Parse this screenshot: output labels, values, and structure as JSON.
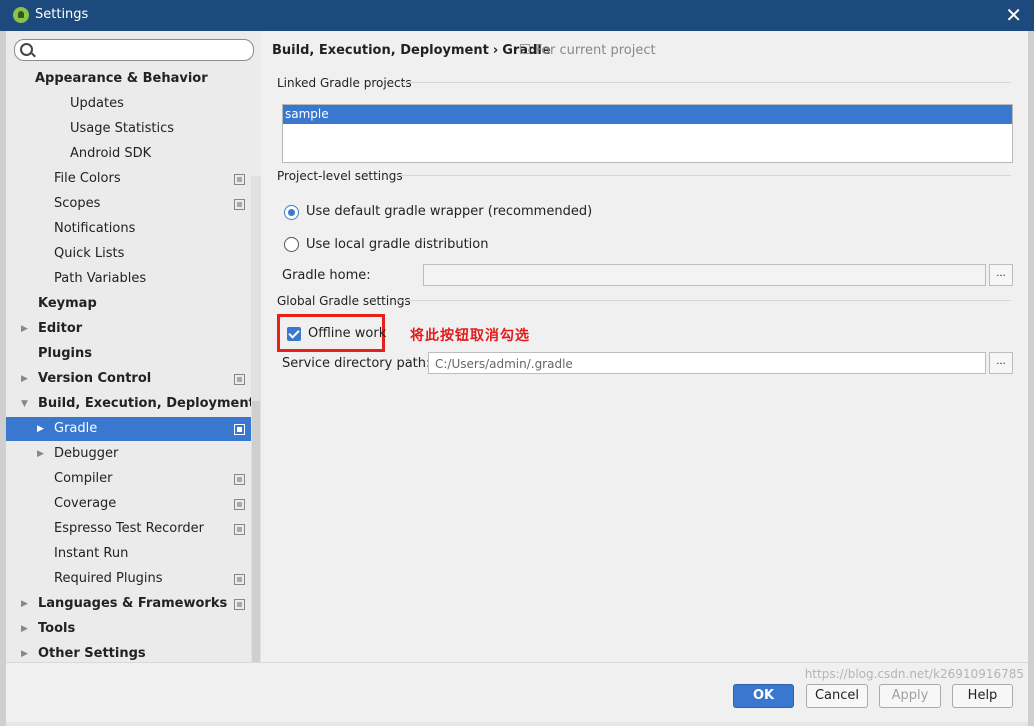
{
  "window": {
    "title": "Settings",
    "close_label": "✕"
  },
  "search": {
    "value": "",
    "placeholder": ""
  },
  "sidebar": {
    "items": [
      {
        "label": "Appearance & Behavior",
        "bold": true,
        "arrow": ""
      },
      {
        "label": "Updates"
      },
      {
        "label": "Usage Statistics"
      },
      {
        "label": "Android SDK"
      },
      {
        "label": "File Colors",
        "project": true
      },
      {
        "label": "Scopes",
        "project": true
      },
      {
        "label": "Notifications"
      },
      {
        "label": "Quick Lists"
      },
      {
        "label": "Path Variables"
      },
      {
        "label": "Keymap",
        "bold": true
      },
      {
        "label": "Editor",
        "bold": true,
        "arrow": "▶"
      },
      {
        "label": "Plugins",
        "bold": true
      },
      {
        "label": "Version Control",
        "bold": true,
        "arrow": "▶",
        "project": true
      },
      {
        "label": "Build, Execution, Deployment",
        "bold": true,
        "arrow": "▼"
      },
      {
        "label": "Gradle",
        "arrow": "▶",
        "project": true,
        "selected": true
      },
      {
        "label": "Debugger",
        "arrow": "▶"
      },
      {
        "label": "Compiler",
        "project": true
      },
      {
        "label": "Coverage",
        "project": true
      },
      {
        "label": "Espresso Test Recorder",
        "project": true
      },
      {
        "label": "Instant Run"
      },
      {
        "label": "Required Plugins",
        "project": true
      },
      {
        "label": "Languages & Frameworks",
        "bold": true,
        "arrow": "▶",
        "project": true
      },
      {
        "label": "Tools",
        "bold": true,
        "arrow": "▶"
      },
      {
        "label": "Other Settings",
        "bold": true,
        "arrow": "▶"
      }
    ]
  },
  "breadcrumb": {
    "parent": "Build, Execution, Deployment",
    "separator": "›",
    "current": "Gradle",
    "scope": "For current project"
  },
  "linked": {
    "title": "Linked Gradle projects",
    "items": [
      "sample"
    ]
  },
  "project_level": {
    "title": "Project-level settings",
    "option_default": "Use default gradle wrapper (recommended)",
    "option_local": "Use local gradle distribution",
    "selected": "default",
    "gradle_home_label": "Gradle home:",
    "gradle_home_value": ""
  },
  "global": {
    "title": "Global Gradle settings",
    "offline_label": "Offline work",
    "offline_checked": true,
    "service_dir_label": "Service directory path:",
    "service_dir_value": "C:/Users/admin/.gradle"
  },
  "annotation": "将此按钮取消勾选",
  "browse_label": "...",
  "buttons": {
    "ok": "OK",
    "cancel": "Cancel",
    "apply": "Apply",
    "help": "Help"
  },
  "watermark": "https://blog.csdn.net/k26910916785",
  "colors": {
    "accent": "#3a78d0",
    "titlebar": "#1d4a7c",
    "annotation": "#e21b1b"
  }
}
